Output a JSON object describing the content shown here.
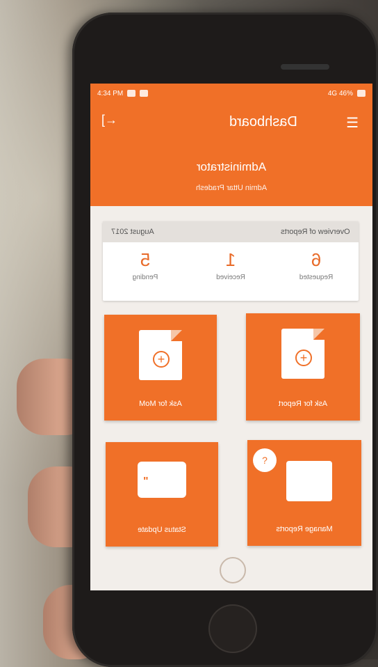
{
  "status_bar": {
    "time": "4:34 PM",
    "indicators": "4G 46%"
  },
  "app_bar": {
    "title": "Dashboard",
    "back_icon": "logout-icon",
    "menu_icon": "hamburger-menu-icon"
  },
  "profile": {
    "name": "Administrator",
    "subtitle": "Admin Uttar Pradesh"
  },
  "overview": {
    "month": "August 2017",
    "heading": "Overview of Reports",
    "stats": [
      {
        "value": "5",
        "label": "Pending"
      },
      {
        "value": "1",
        "label": "Received"
      },
      {
        "value": "6",
        "label": "Requested"
      }
    ]
  },
  "tiles": {
    "ask_mom": "Ask for MoM",
    "ask_report": "Ask for Report",
    "status_update": "Status Update",
    "manage_reports": "Manage Reports"
  },
  "colors": {
    "accent": "#f07028",
    "card_bg": "#ffffff",
    "screen_bg": "#f2eeea"
  }
}
